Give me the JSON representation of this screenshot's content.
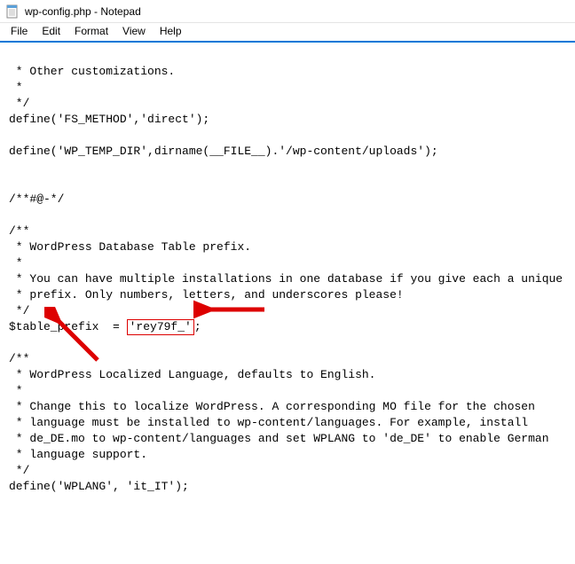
{
  "window": {
    "title": "wp-config.php - Notepad"
  },
  "menu": {
    "file": "File",
    "edit": "Edit",
    "format": "Format",
    "view": "View",
    "help": "Help"
  },
  "code": {
    "l1": " * Other customizations.",
    "l2": " *",
    "l3": " */",
    "l4": "define('FS_METHOD','direct');",
    "l5": "",
    "l6": "define('WP_TEMP_DIR',dirname(__FILE__).'/wp-content/uploads');",
    "l7": "",
    "l8": "",
    "l9": "/**#@-*/",
    "l10": "",
    "l11": "/**",
    "l12": " * WordPress Database Table prefix.",
    "l13": " *",
    "l14": " * You can have multiple installations in one database if you give each a unique",
    "l15": " * prefix. Only numbers, letters, and underscores please!",
    "l16": " */",
    "l17a": "$table_prefix  = ",
    "l17b": "'rey79f_'",
    "l17c": ";",
    "l18": "",
    "l19": "/**",
    "l20": " * WordPress Localized Language, defaults to English.",
    "l21": " *",
    "l22": " * Change this to localize WordPress. A corresponding MO file for the chosen",
    "l23": " * language must be installed to wp-content/languages. For example, install",
    "l24": " * de_DE.mo to wp-content/languages and set WPLANG to 'de_DE' to enable German",
    "l25": " * language support.",
    "l26": " */",
    "l27": "define('WPLANG', 'it_IT');"
  },
  "annotations": {
    "highlight_value": "'rey79f_'"
  }
}
